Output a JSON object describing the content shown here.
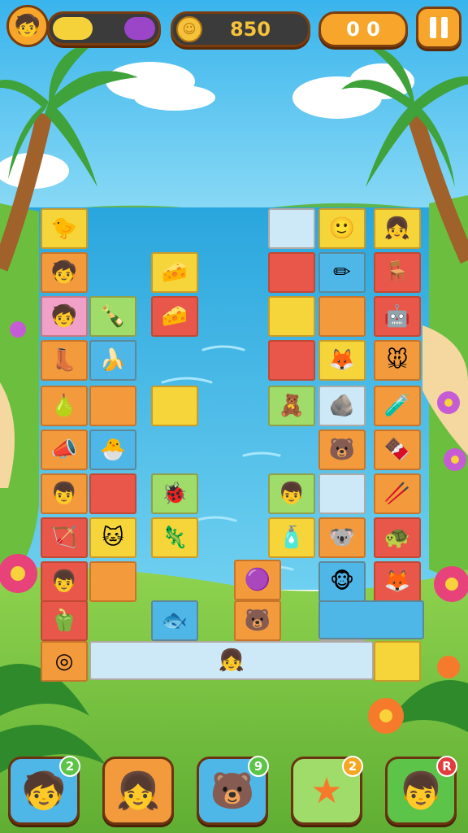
{
  "hud": {
    "energy_fraction": 0.72,
    "coins": "850",
    "moves": "0 0",
    "pause_icon": "pause-icon",
    "coin_icon": "coin-icon",
    "avatar_icon": "player-avatar-icon"
  },
  "colors": {
    "sky": "#55c8f0",
    "water": "#3fb7e8",
    "grass": "#7cc443",
    "hud_orange": "#f7a52b",
    "hud_dark": "#3b3b3b",
    "bar_yellow": "#f5d13a",
    "bar_purple": "#9b45c9"
  },
  "board": {
    "tiles": [
      {
        "id": "t1",
        "color": "#f5d53a",
        "icon": "bird-icon",
        "glyph": "🐤"
      },
      {
        "id": "t2",
        "color": "#f39a3d",
        "icon": "green-kid-icon",
        "glyph": "🧒"
      },
      {
        "id": "t3",
        "color": "#f1a0c8",
        "icon": "purple-kid-icon",
        "glyph": "🧒"
      },
      {
        "id": "t4",
        "color": "#f39a3d",
        "icon": "boot-icon",
        "glyph": "👢"
      },
      {
        "id": "t5",
        "color": "#f39a3d",
        "icon": "capsule-icon",
        "glyph": "💊"
      },
      {
        "id": "t6",
        "color": "#f39a3d",
        "icon": "pear-icon",
        "glyph": "🍐"
      },
      {
        "id": "t7",
        "color": "#f39a3d",
        "icon": "megaphone-icon",
        "glyph": "📣"
      },
      {
        "id": "t8",
        "color": "#f39a3d",
        "icon": "kid-icon",
        "glyph": "👦"
      },
      {
        "id": "t9",
        "color": "#e8574a",
        "icon": "arrows-icon",
        "glyph": "🏹"
      },
      {
        "id": "t10",
        "color": "#e8574a",
        "icon": "blue-hat-kid-icon",
        "glyph": "👦"
      },
      {
        "id": "t11",
        "color": "#e8574a",
        "icon": "pepper-icon",
        "glyph": "🫑"
      },
      {
        "id": "t12",
        "color": "#f39a3d",
        "icon": "coin-tile-icon",
        "glyph": "◎"
      },
      {
        "id": "t13",
        "color": "#9fdc6a",
        "icon": "cork-icon",
        "glyph": "🍾"
      },
      {
        "id": "t14",
        "color": "#4fb7e8",
        "icon": "banana-icon",
        "glyph": "🍌"
      },
      {
        "id": "t15",
        "color": "#f39a3d",
        "icon": "orange-block-icon",
        "glyph": ""
      },
      {
        "id": "t16",
        "color": "#4fb7e8",
        "icon": "sun-creature-icon",
        "glyph": "🐣"
      },
      {
        "id": "t17",
        "color": "#e8574a",
        "icon": "red-block-icon",
        "glyph": ""
      },
      {
        "id": "t18",
        "color": "#f5d53a",
        "icon": "lion-cub-icon",
        "glyph": "🐱"
      },
      {
        "id": "t19",
        "color": "#f39a3d",
        "icon": "orange-block-2-icon",
        "glyph": ""
      },
      {
        "id": "t20",
        "color": "#f5d53a",
        "icon": "cheese-icon",
        "glyph": "🧀"
      },
      {
        "id": "t21",
        "color": "#e8574a",
        "icon": "cheese-slice-icon",
        "glyph": "🧀"
      },
      {
        "id": "t22",
        "color": "#f5d53a",
        "icon": "yellow-block-icon",
        "glyph": ""
      },
      {
        "id": "t23",
        "color": "#9fdc6a",
        "icon": "red-creature-icon",
        "glyph": "🐞"
      },
      {
        "id": "t24",
        "color": "#f5d53a",
        "icon": "green-creature-icon",
        "glyph": "🦎"
      },
      {
        "id": "t25",
        "color": "#f39a3d",
        "icon": "purple-blob-icon",
        "glyph": "🟣"
      },
      {
        "id": "t26",
        "color": "#4fb7e8",
        "icon": "purple-fish-icon",
        "glyph": "🐟"
      },
      {
        "id": "t27",
        "color": "#f39a3d",
        "icon": "bear-face-icon",
        "glyph": "🐻"
      },
      {
        "id": "t28",
        "color": "#cde9f7",
        "icon": "light-block-icon",
        "glyph": ""
      },
      {
        "id": "t29",
        "color": "#e8574a",
        "icon": "red-block-3-icon",
        "glyph": ""
      },
      {
        "id": "t30",
        "color": "#f5d53a",
        "icon": "yellow-block-2-icon",
        "glyph": ""
      },
      {
        "id": "t31",
        "color": "#e8574a",
        "icon": "red-block-4-icon",
        "glyph": ""
      },
      {
        "id": "t32",
        "color": "#9fdc6a",
        "icon": "teddy-icon",
        "glyph": "🧸"
      },
      {
        "id": "t33",
        "color": "#9fdc6a",
        "icon": "beanie-kid-icon",
        "glyph": "👦"
      },
      {
        "id": "t34",
        "color": "#f5d53a",
        "icon": "bottle-icon",
        "glyph": "🧴"
      },
      {
        "id": "t35",
        "color": "#f5d53a",
        "icon": "face-icon",
        "glyph": "🙂"
      },
      {
        "id": "t36",
        "color": "#4fb7e8",
        "icon": "pencil-icon",
        "glyph": "✏"
      },
      {
        "id": "t37",
        "color": "#f39a3d",
        "icon": "orange-block-3-icon",
        "glyph": ""
      },
      {
        "id": "t38",
        "color": "#f5d53a",
        "icon": "red-fox-icon",
        "glyph": "🦊"
      },
      {
        "id": "t39",
        "color": "#cde9f7",
        "icon": "stone-icon",
        "glyph": "🪨"
      },
      {
        "id": "t40",
        "color": "#f39a3d",
        "icon": "bear-icon",
        "glyph": "🐻"
      },
      {
        "id": "t41",
        "color": "#cde9f7",
        "icon": "light-block-2-icon",
        "glyph": ""
      },
      {
        "id": "t42",
        "color": "#f39a3d",
        "icon": "koala-icon",
        "glyph": "🐨"
      },
      {
        "id": "t43",
        "color": "#cde9f7",
        "icon": "light-block-3-icon",
        "glyph": ""
      },
      {
        "id": "t44",
        "color": "#4fb7e8",
        "icon": "monkey-icon",
        "glyph": "🐵"
      },
      {
        "id": "t45",
        "color": "#f5d53a",
        "icon": "blue-kid-icon",
        "glyph": "👧"
      },
      {
        "id": "t46",
        "color": "#e8574a",
        "icon": "bench-icon",
        "glyph": "🪑"
      },
      {
        "id": "t47",
        "color": "#e8574a",
        "icon": "robot-kid-icon",
        "glyph": "🤖"
      },
      {
        "id": "t48",
        "color": "#f39a3d",
        "icon": "mouse-icon",
        "glyph": "🐭"
      },
      {
        "id": "t49",
        "color": "#f39a3d",
        "icon": "bottle-2-icon",
        "glyph": "🧪"
      },
      {
        "id": "t50",
        "color": "#f39a3d",
        "icon": "chocolate-icon",
        "glyph": "🍫"
      },
      {
        "id": "t51",
        "color": "#f39a3d",
        "icon": "sticks-icon",
        "glyph": "🥢"
      },
      {
        "id": "t52",
        "color": "#e8574a",
        "icon": "turtle-kid-icon",
        "glyph": "🐢"
      },
      {
        "id": "t53",
        "color": "#e8574a",
        "icon": "fox-icon",
        "glyph": "🦊"
      },
      {
        "id": "t54",
        "color": "#4fb7e8",
        "icon": "blue-block-icon",
        "glyph": ""
      },
      {
        "id": "t55",
        "color": "#cde9f7",
        "icon": "girl-icon",
        "glyph": "👧"
      },
      {
        "id": "t56",
        "color": "#f5d53a",
        "icon": "bottom-bar-icon",
        "glyph": ""
      }
    ]
  },
  "dock": [
    {
      "icon": "kid-booster-icon",
      "badge": "2",
      "badge_color": "#5cc448"
    },
    {
      "icon": "girl-booster-icon",
      "badge": "",
      "badge_color": ""
    },
    {
      "icon": "bear-booster-icon",
      "badge": "9",
      "badge_color": "#5cc448"
    },
    {
      "icon": "star-booster-icon",
      "badge": "2",
      "badge_color": "#f5a623"
    },
    {
      "icon": "boy-booster-icon",
      "badge": "R",
      "badge_color": "#e23c3c"
    }
  ]
}
